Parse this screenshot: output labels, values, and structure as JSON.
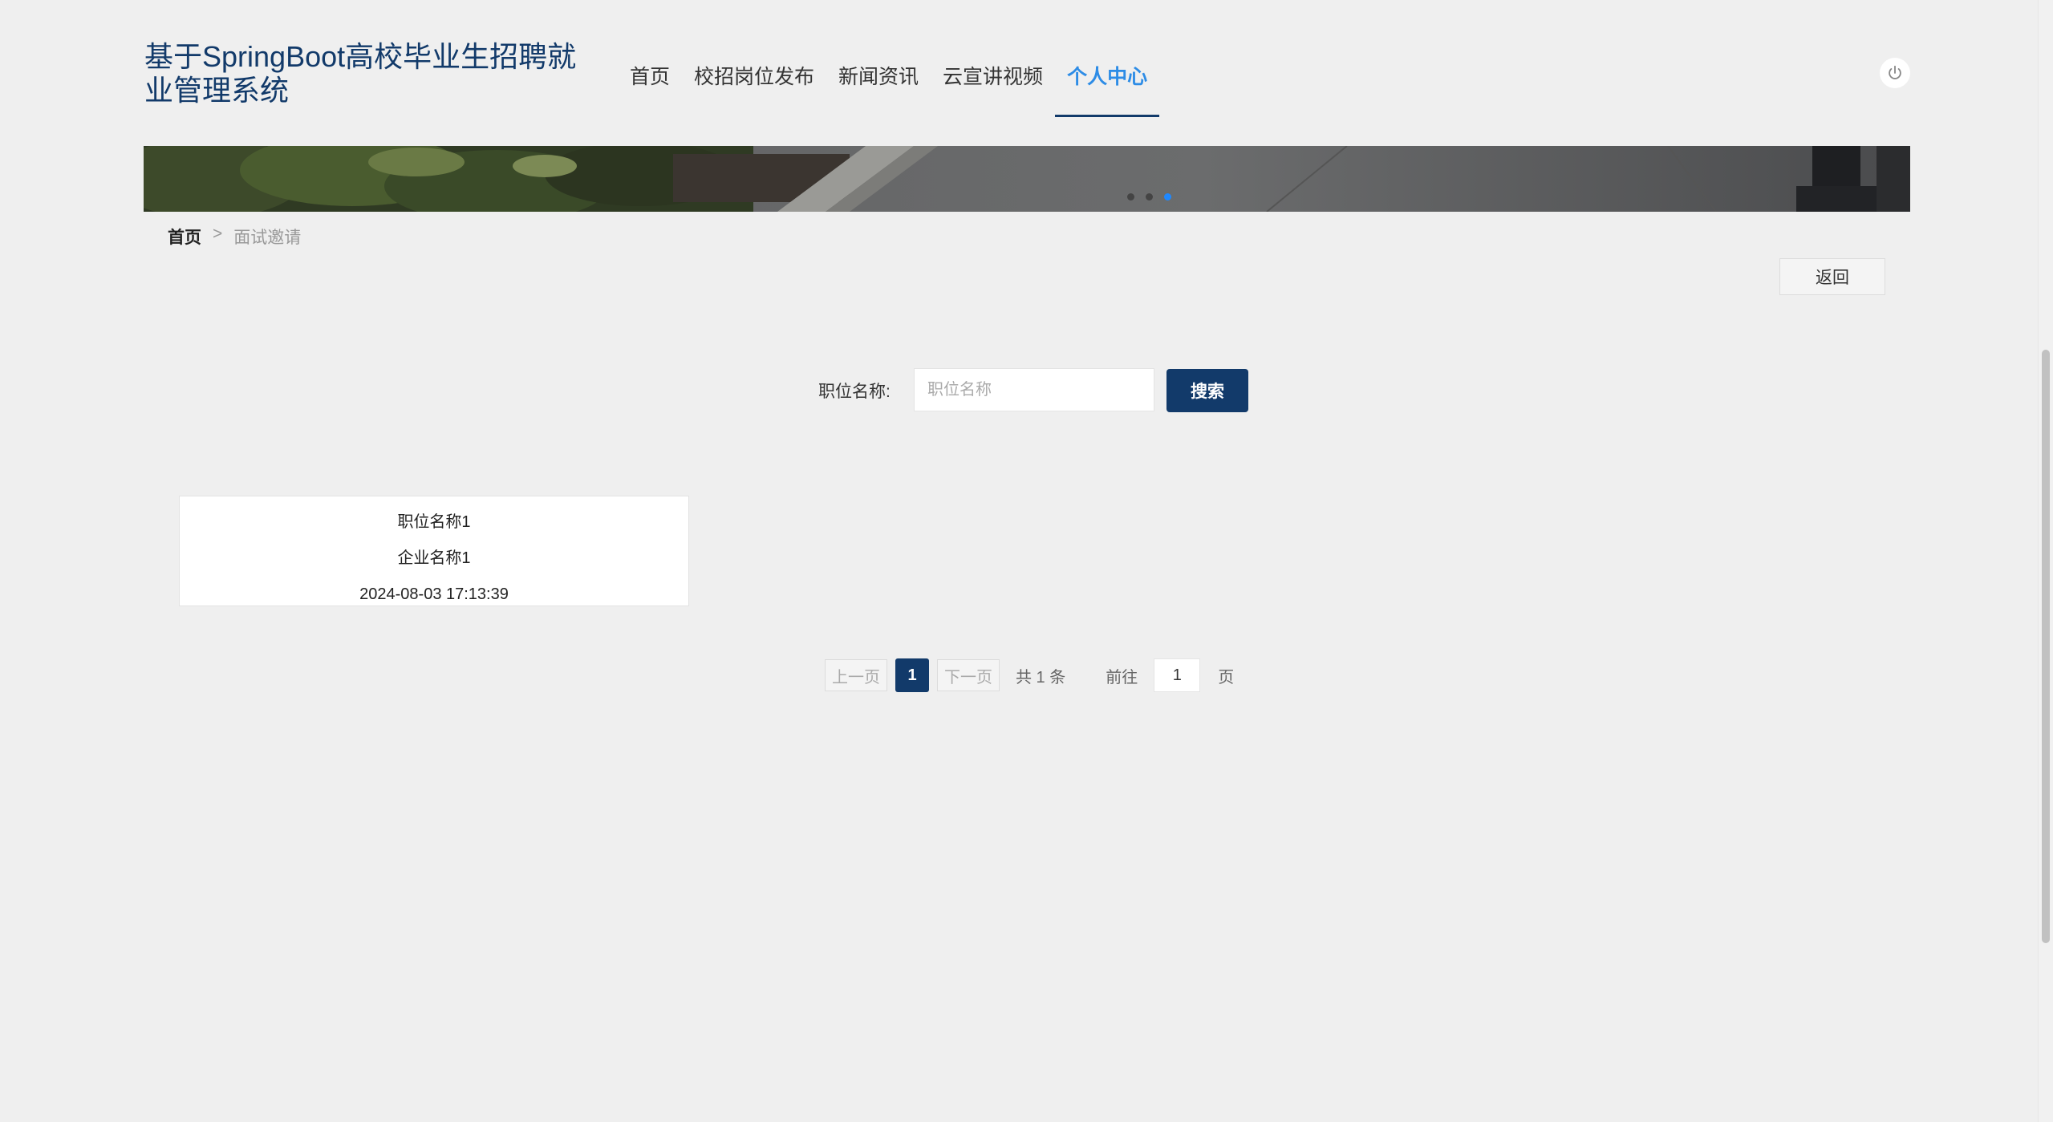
{
  "header": {
    "site_title": "基于SpringBoot高校毕业生招聘就业管理系统",
    "nav": [
      {
        "label": "首页",
        "active": false
      },
      {
        "label": "校招岗位发布",
        "active": false
      },
      {
        "label": "新闻资讯",
        "active": false
      },
      {
        "label": "云宣讲视频",
        "active": false
      },
      {
        "label": "个人中心",
        "active": true
      }
    ],
    "power_icon": "power-icon"
  },
  "banner": {
    "dots": 3,
    "active_dot": 3
  },
  "breadcrumb": {
    "home": "首页",
    "separator": ">",
    "current": "面试邀请"
  },
  "back_button": "返回",
  "search": {
    "label": "职位名称:",
    "placeholder": "职位名称",
    "value": "",
    "button": "搜索"
  },
  "results": [
    {
      "position_name": "职位名称1",
      "company_name": "企业名称1",
      "time": "2024-08-03 17:13:39"
    }
  ],
  "pagination": {
    "prev": "上一页",
    "current_page": "1",
    "next": "下一页",
    "total": "共 1 条",
    "goto_label": "前往",
    "goto_value": "1",
    "page_unit": "页"
  },
  "colors": {
    "primary": "#123a6a",
    "active_nav": "#2d8ce6",
    "background": "#efefef"
  }
}
